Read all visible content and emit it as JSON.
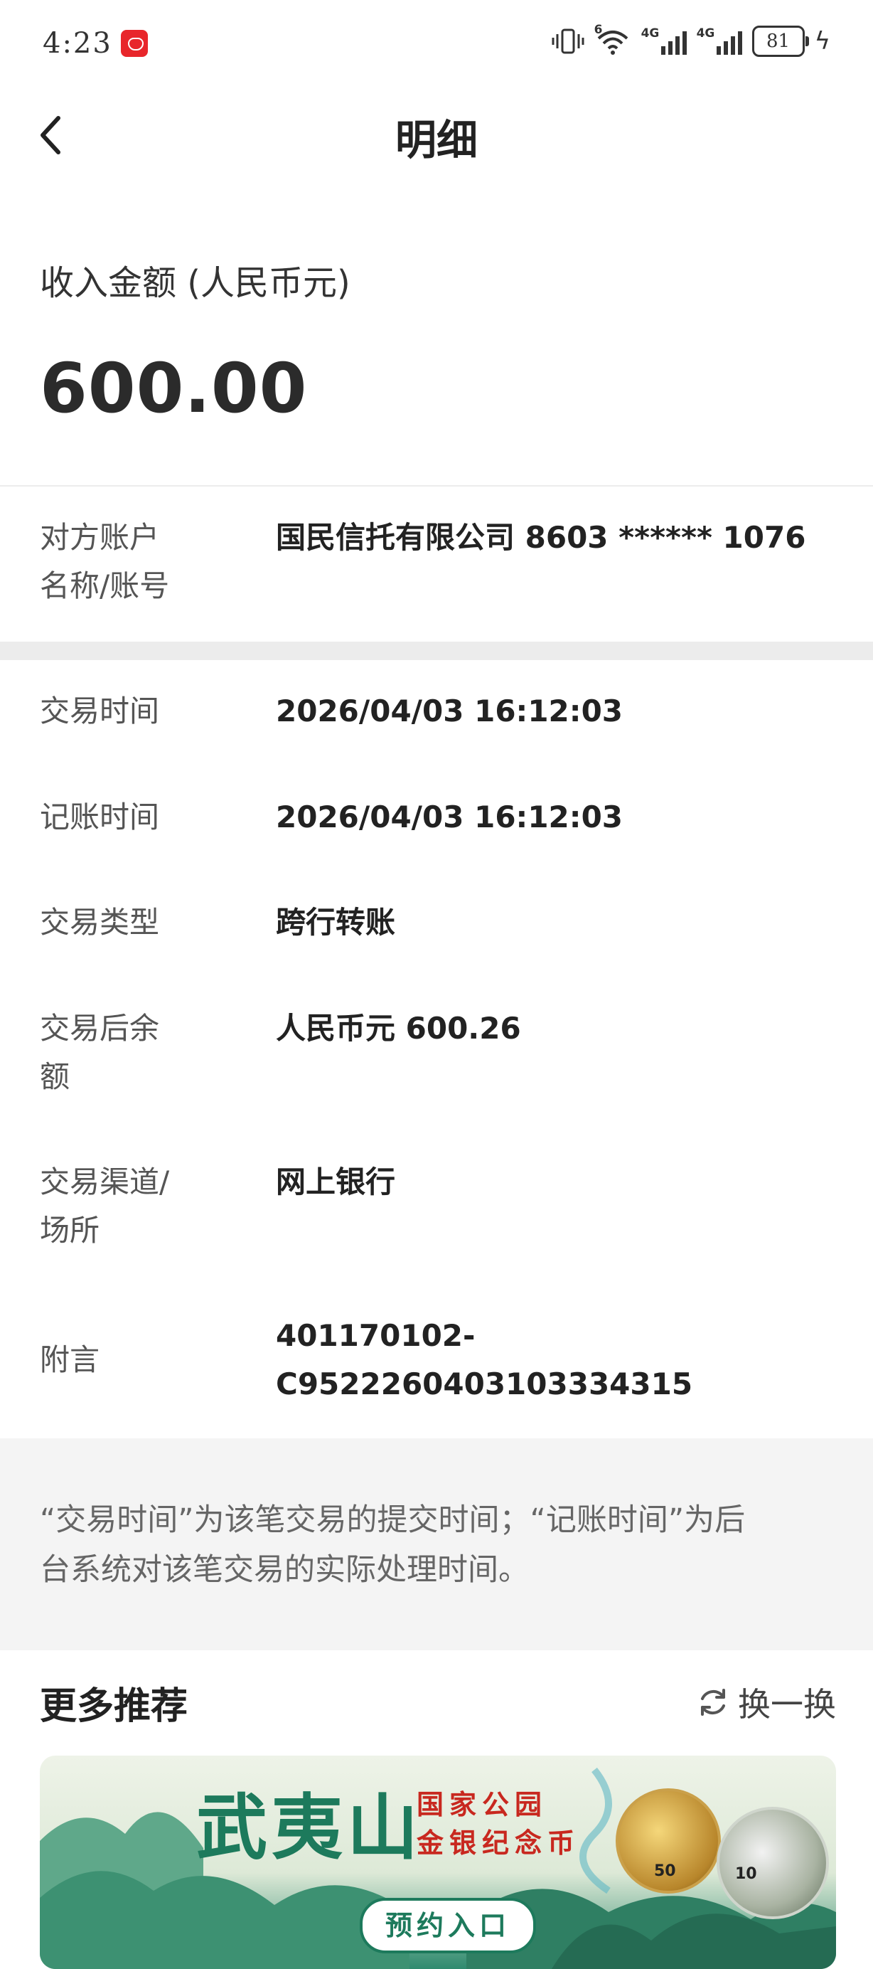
{
  "status_bar": {
    "time": "4:23",
    "network_1": "4G",
    "network_2": "4G",
    "wifi_tag": "6",
    "battery": "81"
  },
  "header": {
    "title": "明细"
  },
  "amount": {
    "label": "收入金额 (人民币元)",
    "value": "600.00"
  },
  "details": {
    "counterparty": {
      "label_line1": "对方账户",
      "label_line2": "名称/账号",
      "value": "国民信托有限公司 8603 ****** 1076"
    },
    "trade_time": {
      "label": "交易时间",
      "value": "2026/04/03 16:12:03"
    },
    "post_time": {
      "label": "记账时间",
      "value": "2026/04/03 16:12:03"
    },
    "trade_type": {
      "label": "交易类型",
      "value": "跨行转账"
    },
    "balance": {
      "label_line1": "交易后余",
      "label_line2": "额",
      "value": "人民币元 600.26"
    },
    "channel": {
      "label_line1": "交易渠道/",
      "label_line2": "场所",
      "value": "网上银行"
    },
    "memo": {
      "label": "附言",
      "value_line1": "401170102-",
      "value_line2": "C952226040310333431­5"
    }
  },
  "note": {
    "text_line1": "“交易时间”为该笔交易的提交时间；“记账时间”为后",
    "text_line2": "台系统对该笔交易的实际处理时间。"
  },
  "recommend": {
    "title": "更多推荐",
    "refresh_label": "换一换"
  },
  "banner": {
    "title": "武夷山",
    "sub_line1": "国家公园",
    "sub_line2": "金银纪念币",
    "cta": "预约入口",
    "gold_coin_value": "50",
    "silver_coin_value": "10"
  },
  "colors": {
    "divider": "#ececec",
    "note_background": "#f4f4f4",
    "banner_green": "#1d7a5c",
    "banner_red": "#c8281f"
  }
}
